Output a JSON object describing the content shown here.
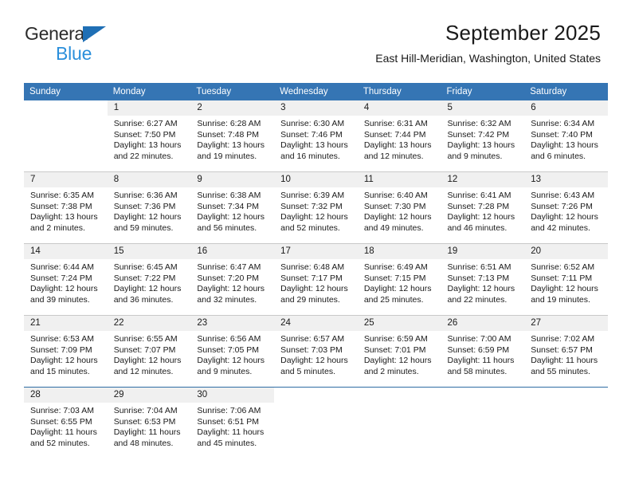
{
  "brand": {
    "name_part1": "General",
    "name_part2": "Blue",
    "accent_color": "#2b8fdb",
    "triangle_color": "#1f6fb5"
  },
  "header": {
    "title": "September 2025",
    "subtitle": "East Hill-Meridian, Washington, United States"
  },
  "calendar": {
    "header_bg": "#3575b4",
    "daynum_bg": "#f0f0f0",
    "weekdays": [
      "Sunday",
      "Monday",
      "Tuesday",
      "Wednesday",
      "Thursday",
      "Friday",
      "Saturday"
    ],
    "weeks": [
      {
        "days": [
          {
            "num": "",
            "blank": true,
            "sunrise": "",
            "sunset": "",
            "daylight1": "",
            "daylight2": ""
          },
          {
            "num": "1",
            "sunrise": "Sunrise: 6:27 AM",
            "sunset": "Sunset: 7:50 PM",
            "daylight1": "Daylight: 13 hours",
            "daylight2": "and 22 minutes."
          },
          {
            "num": "2",
            "sunrise": "Sunrise: 6:28 AM",
            "sunset": "Sunset: 7:48 PM",
            "daylight1": "Daylight: 13 hours",
            "daylight2": "and 19 minutes."
          },
          {
            "num": "3",
            "sunrise": "Sunrise: 6:30 AM",
            "sunset": "Sunset: 7:46 PM",
            "daylight1": "Daylight: 13 hours",
            "daylight2": "and 16 minutes."
          },
          {
            "num": "4",
            "sunrise": "Sunrise: 6:31 AM",
            "sunset": "Sunset: 7:44 PM",
            "daylight1": "Daylight: 13 hours",
            "daylight2": "and 12 minutes."
          },
          {
            "num": "5",
            "sunrise": "Sunrise: 6:32 AM",
            "sunset": "Sunset: 7:42 PM",
            "daylight1": "Daylight: 13 hours",
            "daylight2": "and 9 minutes."
          },
          {
            "num": "6",
            "sunrise": "Sunrise: 6:34 AM",
            "sunset": "Sunset: 7:40 PM",
            "daylight1": "Daylight: 13 hours",
            "daylight2": "and 6 minutes."
          }
        ]
      },
      {
        "days": [
          {
            "num": "7",
            "sunrise": "Sunrise: 6:35 AM",
            "sunset": "Sunset: 7:38 PM",
            "daylight1": "Daylight: 13 hours",
            "daylight2": "and 2 minutes."
          },
          {
            "num": "8",
            "sunrise": "Sunrise: 6:36 AM",
            "sunset": "Sunset: 7:36 PM",
            "daylight1": "Daylight: 12 hours",
            "daylight2": "and 59 minutes."
          },
          {
            "num": "9",
            "sunrise": "Sunrise: 6:38 AM",
            "sunset": "Sunset: 7:34 PM",
            "daylight1": "Daylight: 12 hours",
            "daylight2": "and 56 minutes."
          },
          {
            "num": "10",
            "sunrise": "Sunrise: 6:39 AM",
            "sunset": "Sunset: 7:32 PM",
            "daylight1": "Daylight: 12 hours",
            "daylight2": "and 52 minutes."
          },
          {
            "num": "11",
            "sunrise": "Sunrise: 6:40 AM",
            "sunset": "Sunset: 7:30 PM",
            "daylight1": "Daylight: 12 hours",
            "daylight2": "and 49 minutes."
          },
          {
            "num": "12",
            "sunrise": "Sunrise: 6:41 AM",
            "sunset": "Sunset: 7:28 PM",
            "daylight1": "Daylight: 12 hours",
            "daylight2": "and 46 minutes."
          },
          {
            "num": "13",
            "sunrise": "Sunrise: 6:43 AM",
            "sunset": "Sunset: 7:26 PM",
            "daylight1": "Daylight: 12 hours",
            "daylight2": "and 42 minutes."
          }
        ]
      },
      {
        "days": [
          {
            "num": "14",
            "sunrise": "Sunrise: 6:44 AM",
            "sunset": "Sunset: 7:24 PM",
            "daylight1": "Daylight: 12 hours",
            "daylight2": "and 39 minutes."
          },
          {
            "num": "15",
            "sunrise": "Sunrise: 6:45 AM",
            "sunset": "Sunset: 7:22 PM",
            "daylight1": "Daylight: 12 hours",
            "daylight2": "and 36 minutes."
          },
          {
            "num": "16",
            "sunrise": "Sunrise: 6:47 AM",
            "sunset": "Sunset: 7:20 PM",
            "daylight1": "Daylight: 12 hours",
            "daylight2": "and 32 minutes."
          },
          {
            "num": "17",
            "sunrise": "Sunrise: 6:48 AM",
            "sunset": "Sunset: 7:17 PM",
            "daylight1": "Daylight: 12 hours",
            "daylight2": "and 29 minutes."
          },
          {
            "num": "18",
            "sunrise": "Sunrise: 6:49 AM",
            "sunset": "Sunset: 7:15 PM",
            "daylight1": "Daylight: 12 hours",
            "daylight2": "and 25 minutes."
          },
          {
            "num": "19",
            "sunrise": "Sunrise: 6:51 AM",
            "sunset": "Sunset: 7:13 PM",
            "daylight1": "Daylight: 12 hours",
            "daylight2": "and 22 minutes."
          },
          {
            "num": "20",
            "sunrise": "Sunrise: 6:52 AM",
            "sunset": "Sunset: 7:11 PM",
            "daylight1": "Daylight: 12 hours",
            "daylight2": "and 19 minutes."
          }
        ]
      },
      {
        "days": [
          {
            "num": "21",
            "sunrise": "Sunrise: 6:53 AM",
            "sunset": "Sunset: 7:09 PM",
            "daylight1": "Daylight: 12 hours",
            "daylight2": "and 15 minutes."
          },
          {
            "num": "22",
            "sunrise": "Sunrise: 6:55 AM",
            "sunset": "Sunset: 7:07 PM",
            "daylight1": "Daylight: 12 hours",
            "daylight2": "and 12 minutes."
          },
          {
            "num": "23",
            "sunrise": "Sunrise: 6:56 AM",
            "sunset": "Sunset: 7:05 PM",
            "daylight1": "Daylight: 12 hours",
            "daylight2": "and 9 minutes."
          },
          {
            "num": "24",
            "sunrise": "Sunrise: 6:57 AM",
            "sunset": "Sunset: 7:03 PM",
            "daylight1": "Daylight: 12 hours",
            "daylight2": "and 5 minutes."
          },
          {
            "num": "25",
            "sunrise": "Sunrise: 6:59 AM",
            "sunset": "Sunset: 7:01 PM",
            "daylight1": "Daylight: 12 hours",
            "daylight2": "and 2 minutes."
          },
          {
            "num": "26",
            "sunrise": "Sunrise: 7:00 AM",
            "sunset": "Sunset: 6:59 PM",
            "daylight1": "Daylight: 11 hours",
            "daylight2": "and 58 minutes."
          },
          {
            "num": "27",
            "sunrise": "Sunrise: 7:02 AM",
            "sunset": "Sunset: 6:57 PM",
            "daylight1": "Daylight: 11 hours",
            "daylight2": "and 55 minutes."
          }
        ]
      },
      {
        "days": [
          {
            "num": "28",
            "sunrise": "Sunrise: 7:03 AM",
            "sunset": "Sunset: 6:55 PM",
            "daylight1": "Daylight: 11 hours",
            "daylight2": "and 52 minutes."
          },
          {
            "num": "29",
            "sunrise": "Sunrise: 7:04 AM",
            "sunset": "Sunset: 6:53 PM",
            "daylight1": "Daylight: 11 hours",
            "daylight2": "and 48 minutes."
          },
          {
            "num": "30",
            "sunrise": "Sunrise: 7:06 AM",
            "sunset": "Sunset: 6:51 PM",
            "daylight1": "Daylight: 11 hours",
            "daylight2": "and 45 minutes."
          },
          {
            "num": "",
            "blank": true,
            "sunrise": "",
            "sunset": "",
            "daylight1": "",
            "daylight2": ""
          },
          {
            "num": "",
            "blank": true,
            "sunrise": "",
            "sunset": "",
            "daylight1": "",
            "daylight2": ""
          },
          {
            "num": "",
            "blank": true,
            "sunrise": "",
            "sunset": "",
            "daylight1": "",
            "daylight2": ""
          },
          {
            "num": "",
            "blank": true,
            "sunrise": "",
            "sunset": "",
            "daylight1": "",
            "daylight2": ""
          }
        ]
      }
    ]
  }
}
